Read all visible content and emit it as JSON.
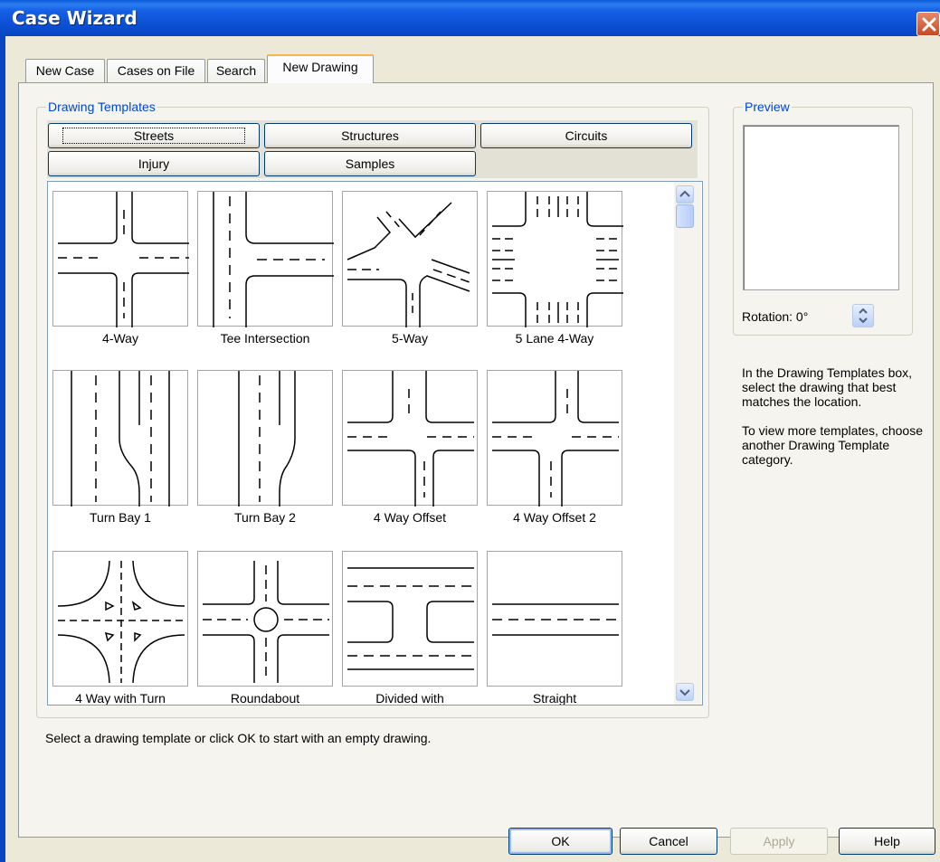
{
  "window": {
    "title": "Case Wizard"
  },
  "tabs": [
    "New Case",
    "Cases on File",
    "Search",
    "New Drawing"
  ],
  "active_tab": "New Drawing",
  "templates_group": {
    "legend": "Drawing Templates",
    "categories": [
      "Streets",
      "Structures",
      "Circuits",
      "Injury",
      "Samples"
    ],
    "active_category": "Streets",
    "items": [
      "4-Way",
      "Tee Intersection",
      "5-Way",
      "5 Lane 4-Way",
      "Turn Bay 1",
      "Turn Bay 2",
      "4 Way Offset",
      "4 Way Offset 2",
      "4 Way with Turn",
      "Roundabout",
      "Divided with",
      "Straight"
    ]
  },
  "preview_group": {
    "legend": "Preview",
    "rotation_label": "Rotation: 0°"
  },
  "help": {
    "p1": "In the Drawing Templates box, select the drawing that best matches the location.",
    "p2": "To view more templates, choose another Drawing Template category."
  },
  "status": "Select a drawing template or click OK to start with an empty drawing.",
  "buttons": {
    "ok": "OK",
    "cancel": "Cancel",
    "apply": "Apply",
    "help": "Help"
  },
  "icons": {
    "close": "close-icon",
    "scroll_up": "arrow-up-icon",
    "scroll_down": "arrow-down-icon",
    "spin": "spinner-icon"
  },
  "colors": {
    "title_bar": "#0c4fd2",
    "group_legend": "#0046d5",
    "close_button": "#c84a26"
  }
}
